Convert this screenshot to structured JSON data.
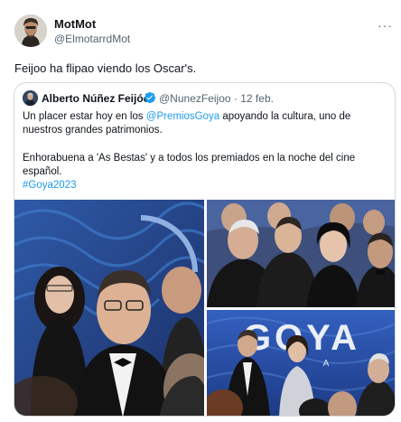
{
  "tweet": {
    "author_name": "MotMot",
    "author_handle": "@ElmotarrdMot",
    "more_icon": "more-horizontal-icon",
    "text": "Feijoo ha flipao viendo los Oscar's."
  },
  "quoted_tweet": {
    "author_name": "Alberto Núñez Feijóo",
    "verified_icon": "verified-badge-icon",
    "author_handle": "@NunezFeijoo",
    "separator": "·",
    "date": "12 feb.",
    "line1_prefix": "Un placer estar hoy en los ",
    "line1_mention": "@PremiosGoya",
    "line1_suffix": " apoyando la cultura, uno de",
    "line2": "nuestros grandes patrimonios.",
    "line3": "Enhorabuena a 'As Bestas' y a todos los premiados en la noche del cine",
    "line4": "español.",
    "hashtag": "#Goya2023"
  },
  "photos": {
    "sign_text": "GOYA",
    "sign_subtext": "A",
    "count": 3
  },
  "colors": {
    "link": "#1d9bf0",
    "verified": "#1d9bf0",
    "border": "#cfd9de",
    "secondary_text": "#536471",
    "stage_blue": "#2a4ea8"
  }
}
